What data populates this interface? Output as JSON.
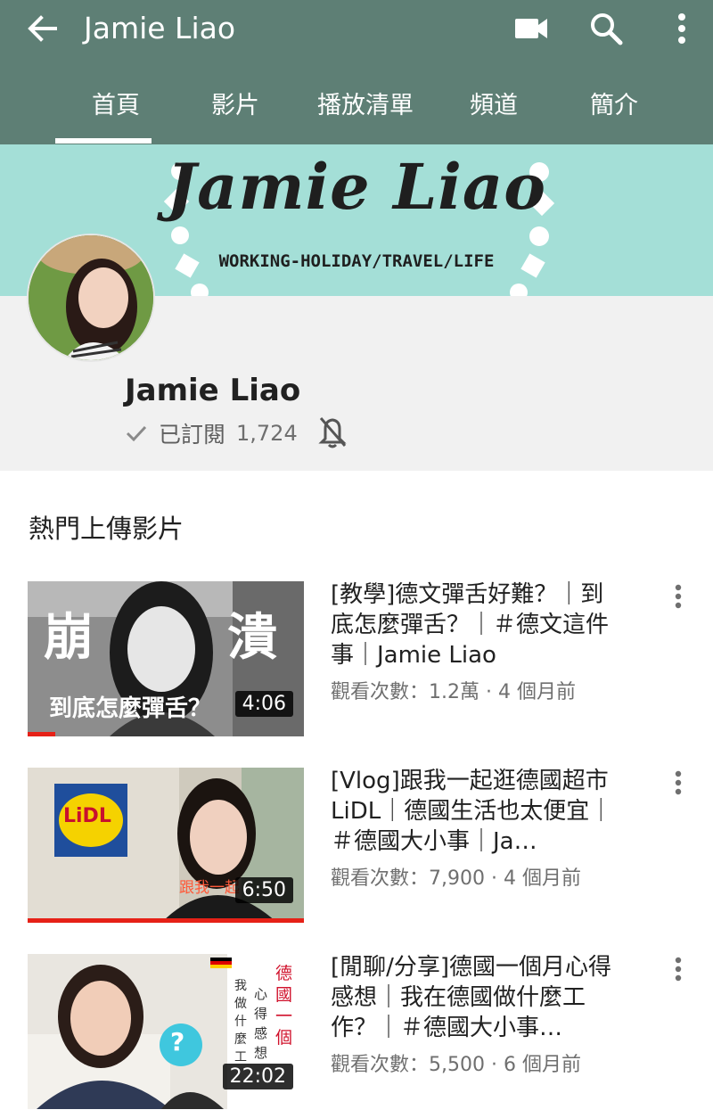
{
  "appbar": {
    "back_icon": "arrow-back-icon",
    "title": "Jamie Liao",
    "actions": [
      "video-camera-icon",
      "search-icon",
      "more-vert-icon"
    ],
    "background": "#5e7f75"
  },
  "tabs": [
    {
      "label": "首頁",
      "selected": true
    },
    {
      "label": "影片",
      "selected": false
    },
    {
      "label": "播放清單",
      "selected": false
    },
    {
      "label": "頻道",
      "selected": false
    },
    {
      "label": "簡介",
      "selected": false
    }
  ],
  "banner": {
    "title": "Jamie Liao",
    "subtitle": "WORKING-HOLIDAY/TRAVEL/LIFE",
    "background": "#a4dfd7"
  },
  "channel": {
    "name": "Jamie Liao",
    "subscribed_label": "已訂閱",
    "subscriber_count": "1,724",
    "icons": [
      "check-icon",
      "bell-off-icon"
    ]
  },
  "section": {
    "title": "熱門上傳影片"
  },
  "videos": [
    {
      "title": "[教學]德文彈舌好難？｜到底怎麼彈舌？｜＃德文這件事｜Jamie Liao",
      "meta": "觀看次數：1.2萬 · 4 個月前",
      "duration": "4:06",
      "watched_fraction": 0.1,
      "thumb_text": {
        "left": "崩",
        "right": "潰",
        "caption": "到底怎麼彈舌？"
      }
    },
    {
      "title": "[Vlog]跟我一起逛德國超市LiDL｜德國生活也太便宜｜＃德國大小事｜Ja…",
      "meta": "觀看次數：7,900 · 4 個月前",
      "duration": "6:50",
      "watched_fraction": 1.0,
      "thumb_text": {
        "logo": "LiDL",
        "caption": "跟我一起"
      }
    },
    {
      "title": "[閒聊/分享]德國一個月心得感想｜我在德國做什麼工作？｜＃德國大小事…",
      "meta": "觀看次數：5,500 · 6 個月前",
      "duration": "22:02",
      "watched_fraction": 0,
      "thumb_text": {
        "col1": "德國一個",
        "col2": "心得感想",
        "col3": "我做什麼工",
        "badge": "?"
      }
    }
  ]
}
